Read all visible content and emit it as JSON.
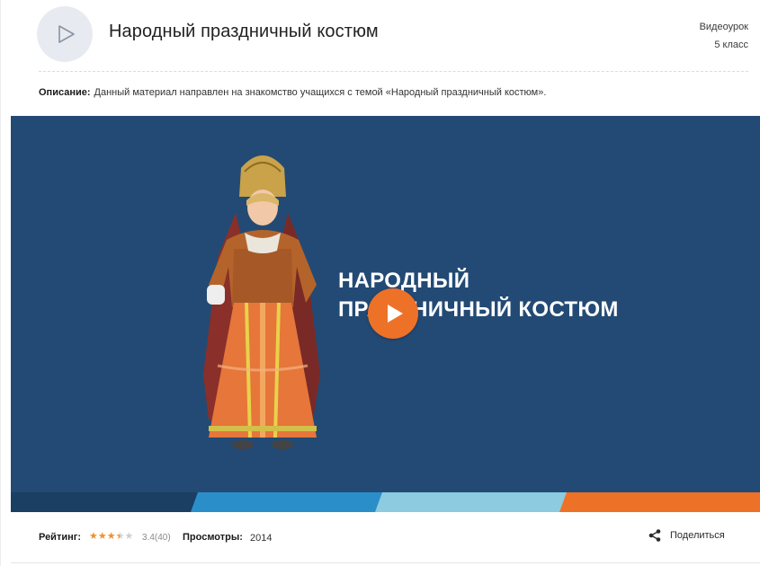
{
  "header": {
    "title": "Народный праздничный костюм",
    "type": "Видеоурок",
    "grade": "5 класс"
  },
  "description": {
    "label": "Описание:",
    "text": "Данный материал направлен на знакомство учащихся с темой «Народный праздничный костюм»."
  },
  "video": {
    "title_line1": "НАРОДНЫЙ",
    "title_line2": "ПРАЗДНИЧНЫЙ КОСТЮМ",
    "stripe_colors": [
      "#1a3f63",
      "#2a8fc9",
      "#8ccbe0",
      "#ee7128"
    ],
    "play_color": "#ee7128",
    "background_color": "#234a74"
  },
  "footer": {
    "rating_label": "Рейтинг:",
    "rating_value": "3.4",
    "rating_count": "(40)",
    "rating_stars": 3.4,
    "views_label": "Просмотры:",
    "views_value": "2014",
    "share_label": "Поделиться"
  },
  "icons": {
    "header_play": "play-outline-icon",
    "video_play": "play-icon",
    "share": "share-icon",
    "star": "star-icon"
  },
  "colors": {
    "star_filled": "#f0902e",
    "star_empty": "#cfcfcf"
  }
}
